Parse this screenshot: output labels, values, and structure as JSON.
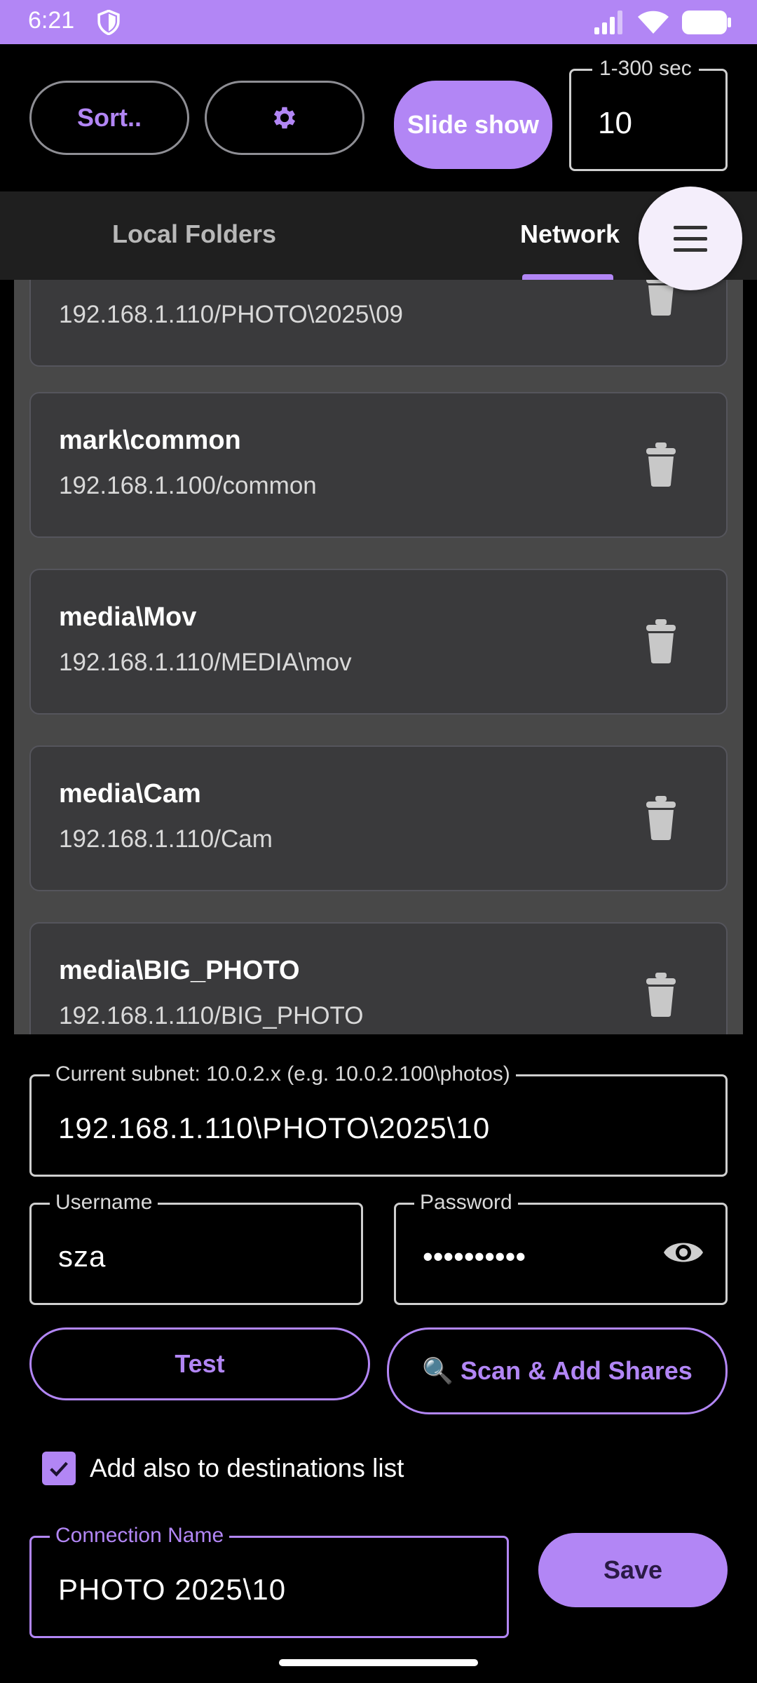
{
  "status_bar": {
    "time": "6:21"
  },
  "toolbar": {
    "sort_label": "Sort..",
    "slideshow_label": "Slide show",
    "interval_label": "1-300 sec",
    "interval_value": "10"
  },
  "tabs": [
    {
      "label": "Local Folders",
      "selected": false
    },
    {
      "label": "Network",
      "selected": true
    }
  ],
  "connections": [
    {
      "name": "",
      "path": "192.168.1.110/PHOTO\\2025\\09"
    },
    {
      "name": "mark\\common",
      "path": "192.168.1.100/common"
    },
    {
      "name": "media\\Mov",
      "path": "192.168.1.110/MEDIA\\mov"
    },
    {
      "name": "media\\Cam",
      "path": "192.168.1.110/Cam"
    },
    {
      "name": "media\\BIG_PHOTO",
      "path": "192.168.1.110/BIG_PHOTO"
    }
  ],
  "form": {
    "subnet_label": "Current subnet: 10.0.2.x (e.g. 10.0.2.100\\photos)",
    "subnet_value": "192.168.1.110\\PHOTO\\2025\\10",
    "username_label": "Username",
    "username_value": "sza",
    "password_label": "Password",
    "password_value": "••••••••••",
    "test_label": "Test",
    "scan_label": "🔍 Scan & Add Shares",
    "add_destinations_label": "Add also to destinations list",
    "add_destinations_checked": true,
    "connection_name_label": "Connection Name",
    "connection_name_value": "PHOTO 2025\\10",
    "save_label": "Save"
  },
  "colors": {
    "accent": "#b286f5",
    "list_bg": "#484848",
    "card_bg": "#3a3a3c"
  }
}
